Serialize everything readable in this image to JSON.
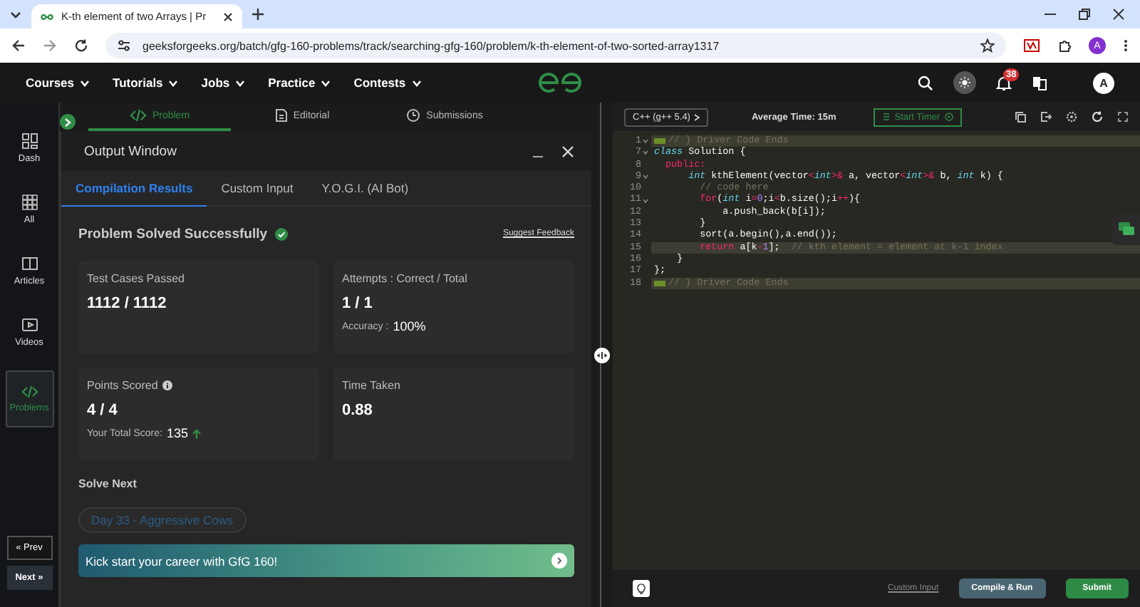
{
  "browser": {
    "tab_title": "K-th element of two Arrays | Pr",
    "url": "geeksforgeeks.org/batch/gfg-160-problems/track/searching-gfg-160/problem/k-th-element-of-two-sorted-array1317",
    "profile_initial": "A"
  },
  "site_nav": {
    "menus": [
      "Courses",
      "Tutorials",
      "Jobs",
      "Practice",
      "Contests"
    ],
    "notification_count": "38",
    "avatar": "A"
  },
  "sidebar": {
    "items": [
      {
        "label": "Dash",
        "selected": false
      },
      {
        "label": "All",
        "selected": false
      },
      {
        "label": "Articles",
        "selected": false
      },
      {
        "label": "Videos",
        "selected": false
      },
      {
        "label": "Problems",
        "selected": true
      }
    ],
    "prev": "« Prev",
    "next": "Next »"
  },
  "problem_tabs": [
    {
      "label": "Problem",
      "selected": true
    },
    {
      "label": "Editorial",
      "selected": false
    },
    {
      "label": "Submissions",
      "selected": false
    }
  ],
  "output_window": {
    "title": "Output Window",
    "tabs": [
      {
        "label": "Compilation Results",
        "selected": true
      },
      {
        "label": "Custom Input",
        "selected": false
      },
      {
        "label": "Y.O.G.I. (AI Bot)",
        "selected": false
      }
    ],
    "status": "Problem Solved Successfully",
    "feedback_link": "Suggest Feedback",
    "cards": [
      {
        "label": "Test Cases Passed",
        "value": "1112 / 1112"
      },
      {
        "label": "Attempts : Correct / Total",
        "value": "1 / 1",
        "note_label": "Accuracy :",
        "note_value": "100%"
      },
      {
        "label": "Points Scored",
        "value": "4 / 4",
        "info": true,
        "note_label": "Your Total Score:",
        "note_value": "135",
        "rising": true
      },
      {
        "label": "Time Taken",
        "value": "0.88"
      }
    ],
    "solve_next_heading": "Solve Next",
    "next_problem": "Day 33 - Aggressive Cows",
    "banner": "Kick start your career with GfG 160!"
  },
  "editor": {
    "language": "C++ (g++ 5.4)",
    "average_time": "Average Time: 15m",
    "timer_button": "Start Timer",
    "lines": [
      {
        "number": "1",
        "foldable": true,
        "folded": true,
        "current": false,
        "tokens": [
          {
            "kind": "comment",
            "t": "// } Driver Code Ends"
          }
        ]
      },
      {
        "number": "7",
        "foldable": true,
        "folded": false,
        "current": false,
        "tokens": [
          {
            "kind": "storage",
            "t": "class"
          },
          {
            "kind": "plain",
            "t": " Solution {"
          }
        ]
      },
      {
        "number": "8",
        "foldable": false,
        "folded": false,
        "current": false,
        "tokens": [
          {
            "kind": "keyword",
            "t": "  public:"
          }
        ]
      },
      {
        "number": "9",
        "foldable": true,
        "folded": false,
        "current": false,
        "tokens": [
          {
            "kind": "storage",
            "t": "      int"
          },
          {
            "kind": "plain",
            "t": " kthElement(vector"
          },
          {
            "kind": "operator",
            "t": "<"
          },
          {
            "kind": "storage",
            "t": "int"
          },
          {
            "kind": "operator",
            "t": ">&"
          },
          {
            "kind": "plain",
            "t": " a, vector"
          },
          {
            "kind": "operator",
            "t": "<"
          },
          {
            "kind": "storage",
            "t": "int"
          },
          {
            "kind": "operator",
            "t": ">&"
          },
          {
            "kind": "plain",
            "t": " b, "
          },
          {
            "kind": "storage",
            "t": "int"
          },
          {
            "kind": "plain",
            "t": " k) {"
          }
        ]
      },
      {
        "number": "10",
        "foldable": false,
        "folded": false,
        "current": false,
        "tokens": [
          {
            "kind": "comment",
            "t": "        // code here"
          }
        ]
      },
      {
        "number": "11",
        "foldable": true,
        "folded": false,
        "current": false,
        "tokens": [
          {
            "kind": "keyword",
            "t": "        for"
          },
          {
            "kind": "plain",
            "t": "("
          },
          {
            "kind": "storage",
            "t": "int"
          },
          {
            "kind": "plain",
            "t": " i"
          },
          {
            "kind": "operator",
            "t": "="
          },
          {
            "kind": "number",
            "t": "0"
          },
          {
            "kind": "plain",
            "t": ";i"
          },
          {
            "kind": "operator",
            "t": "<"
          },
          {
            "kind": "plain",
            "t": "b.size();i"
          },
          {
            "kind": "operator",
            "t": "++"
          },
          {
            "kind": "plain",
            "t": "){"
          }
        ]
      },
      {
        "number": "12",
        "foldable": false,
        "folded": false,
        "current": false,
        "tokens": [
          {
            "kind": "plain",
            "t": "            a.push_back(b[i]);"
          }
        ]
      },
      {
        "number": "13",
        "foldable": false,
        "folded": false,
        "current": false,
        "tokens": [
          {
            "kind": "plain",
            "t": "        }"
          }
        ]
      },
      {
        "number": "14",
        "foldable": false,
        "folded": false,
        "current": false,
        "tokens": [
          {
            "kind": "plain",
            "t": "        sort(a.begin(),a.end());"
          }
        ]
      },
      {
        "number": "15",
        "foldable": false,
        "folded": false,
        "current": true,
        "tokens": [
          {
            "kind": "keyword",
            "t": "        return"
          },
          {
            "kind": "plain",
            "t": " a[k"
          },
          {
            "kind": "operator",
            "t": "-"
          },
          {
            "kind": "number",
            "t": "1"
          },
          {
            "kind": "plain",
            "t": "];  "
          },
          {
            "kind": "comment",
            "t": "// kth element = element at k-1 index"
          }
        ]
      },
      {
        "number": "16",
        "foldable": false,
        "folded": false,
        "current": false,
        "tokens": [
          {
            "kind": "plain",
            "t": "    }"
          }
        ]
      },
      {
        "number": "17",
        "foldable": false,
        "folded": false,
        "current": false,
        "tokens": [
          {
            "kind": "plain",
            "t": "};"
          }
        ]
      },
      {
        "number": "18",
        "foldable": false,
        "folded": true,
        "current": false,
        "tokens": [
          {
            "kind": "comment",
            "t": "// } Driver Code Ends"
          }
        ]
      }
    ]
  },
  "footer": {
    "custom_input": "Custom Input",
    "run": "Compile & Run",
    "submit": "Submit"
  }
}
